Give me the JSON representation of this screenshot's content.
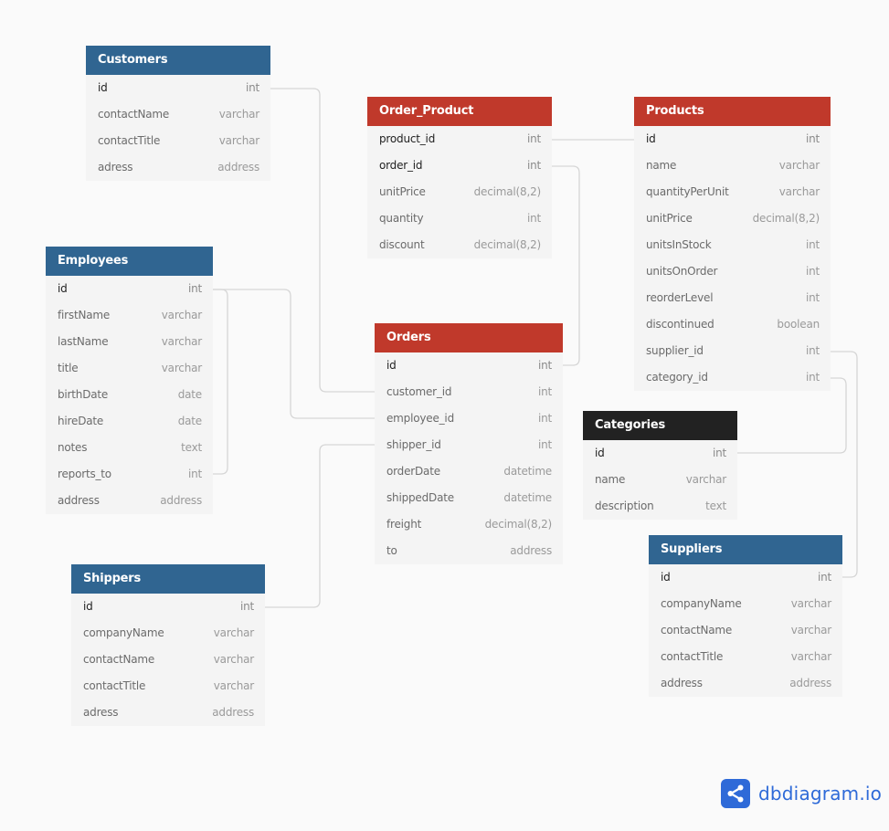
{
  "tables": {
    "customers": {
      "name": "Customers",
      "color": "blue",
      "fields": [
        {
          "name": "id",
          "type": "int",
          "key": true
        },
        {
          "name": "contactName",
          "type": "varchar"
        },
        {
          "name": "contactTitle",
          "type": "varchar"
        },
        {
          "name": "adress",
          "type": "address"
        }
      ]
    },
    "order_product": {
      "name": "Order_Product",
      "color": "red",
      "fields": [
        {
          "name": "product_id",
          "type": "int",
          "key": true
        },
        {
          "name": "order_id",
          "type": "int",
          "key": true
        },
        {
          "name": "unitPrice",
          "type": "decimal(8,2)"
        },
        {
          "name": "quantity",
          "type": "int"
        },
        {
          "name": "discount",
          "type": "decimal(8,2)"
        }
      ]
    },
    "products": {
      "name": "Products",
      "color": "red",
      "fields": [
        {
          "name": "id",
          "type": "int",
          "key": true
        },
        {
          "name": "name",
          "type": "varchar"
        },
        {
          "name": "quantityPerUnit",
          "type": "varchar"
        },
        {
          "name": "unitPrice",
          "type": "decimal(8,2)"
        },
        {
          "name": "unitsInStock",
          "type": "int"
        },
        {
          "name": "unitsOnOrder",
          "type": "int"
        },
        {
          "name": "reorderLevel",
          "type": "int"
        },
        {
          "name": "discontinued",
          "type": "boolean"
        },
        {
          "name": "supplier_id",
          "type": "int"
        },
        {
          "name": "category_id",
          "type": "int"
        }
      ]
    },
    "employees": {
      "name": "Employees",
      "color": "blue",
      "fields": [
        {
          "name": "id",
          "type": "int",
          "key": true
        },
        {
          "name": "firstName",
          "type": "varchar"
        },
        {
          "name": "lastName",
          "type": "varchar"
        },
        {
          "name": "title",
          "type": "varchar"
        },
        {
          "name": "birthDate",
          "type": "date"
        },
        {
          "name": "hireDate",
          "type": "date"
        },
        {
          "name": "notes",
          "type": "text"
        },
        {
          "name": "reports_to",
          "type": "int"
        },
        {
          "name": "address",
          "type": "address"
        }
      ]
    },
    "orders": {
      "name": "Orders",
      "color": "red",
      "fields": [
        {
          "name": "id",
          "type": "int",
          "key": true
        },
        {
          "name": "customer_id",
          "type": "int"
        },
        {
          "name": "employee_id",
          "type": "int"
        },
        {
          "name": "shipper_id",
          "type": "int"
        },
        {
          "name": "orderDate",
          "type": "datetime"
        },
        {
          "name": "shippedDate",
          "type": "datetime"
        },
        {
          "name": "freight",
          "type": "decimal(8,2)"
        },
        {
          "name": "to",
          "type": "address"
        }
      ]
    },
    "categories": {
      "name": "Categories",
      "color": "black",
      "fields": [
        {
          "name": "id",
          "type": "int",
          "key": true
        },
        {
          "name": "name",
          "type": "varchar"
        },
        {
          "name": "description",
          "type": "text"
        }
      ]
    },
    "shippers": {
      "name": "Shippers",
      "color": "blue",
      "fields": [
        {
          "name": "id",
          "type": "int",
          "key": true
        },
        {
          "name": "companyName",
          "type": "varchar"
        },
        {
          "name": "contactName",
          "type": "varchar"
        },
        {
          "name": "contactTitle",
          "type": "varchar"
        },
        {
          "name": "adress",
          "type": "address"
        }
      ]
    },
    "suppliers": {
      "name": "Suppliers",
      "color": "blue",
      "fields": [
        {
          "name": "id",
          "type": "int",
          "key": true
        },
        {
          "name": "companyName",
          "type": "varchar"
        },
        {
          "name": "contactName",
          "type": "varchar"
        },
        {
          "name": "contactTitle",
          "type": "varchar"
        },
        {
          "name": "address",
          "type": "address"
        }
      ]
    }
  },
  "relations": [
    {
      "from": "Customers.id",
      "to": "Orders.customer_id"
    },
    {
      "from": "Employees.id",
      "to": "Orders.employee_id"
    },
    {
      "from": "Employees.id",
      "to": "Employees.reports_to"
    },
    {
      "from": "Shippers.id",
      "to": "Orders.shipper_id"
    },
    {
      "from": "Order_Product.product_id",
      "to": "Products.id"
    },
    {
      "from": "Order_Product.order_id",
      "to": "Orders.id"
    },
    {
      "from": "Products.supplier_id",
      "to": "Suppliers.id"
    },
    {
      "from": "Products.category_id",
      "to": "Categories.id"
    }
  ],
  "colors": {
    "blue": "#306591",
    "red": "#c0392b",
    "black": "#222222",
    "brand": "#2e6ad8"
  },
  "brand": {
    "label": "dbdiagram.io",
    "icon": "share-icon"
  }
}
